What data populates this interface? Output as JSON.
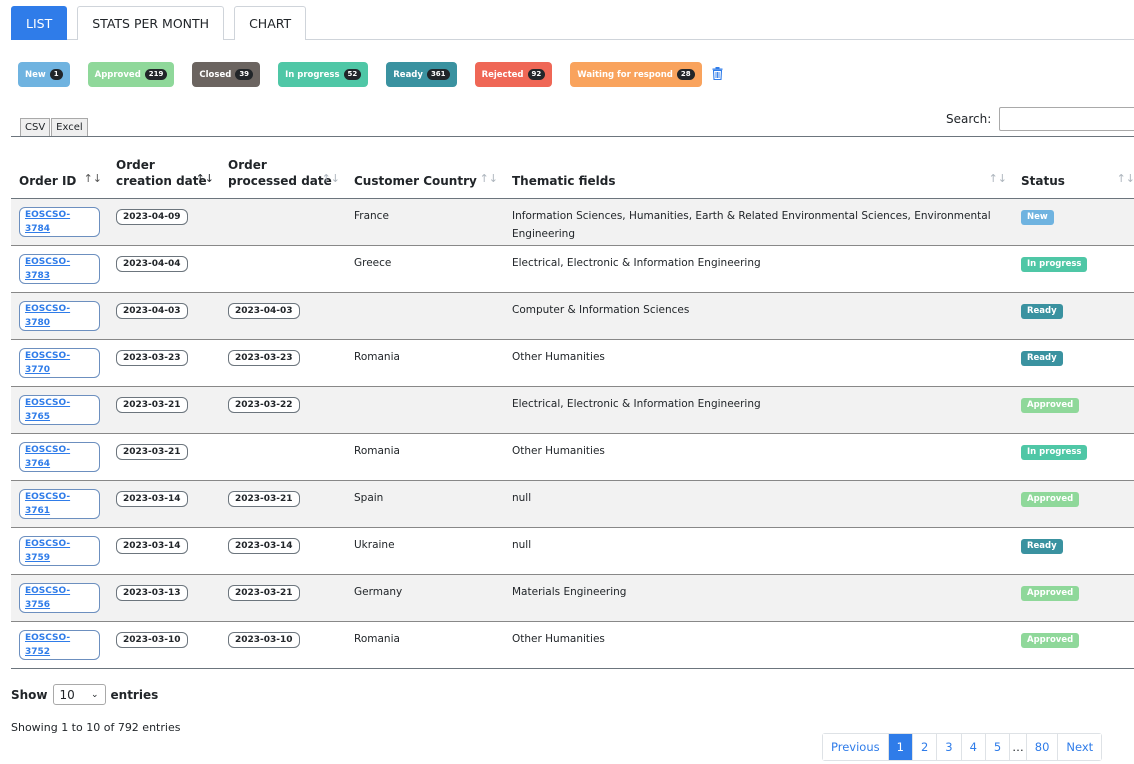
{
  "tabs": [
    {
      "label": "LIST",
      "active": true
    },
    {
      "label": "STATS PER MONTH",
      "active": false
    },
    {
      "label": "CHART",
      "active": false
    }
  ],
  "filters": [
    {
      "label": "New",
      "count": "1",
      "color": "#6fb3e0"
    },
    {
      "label": "Approved",
      "count": "219",
      "color": "#8fd89a"
    },
    {
      "label": "Closed",
      "count": "39",
      "color": "#6b6460"
    },
    {
      "label": "In progress",
      "count": "52",
      "color": "#4fc7a6"
    },
    {
      "label": "Ready",
      "count": "361",
      "color": "#3a92a0"
    },
    {
      "label": "Rejected",
      "count": "92",
      "color": "#ef6756"
    },
    {
      "label": "Waiting for respond",
      "count": "28",
      "color": "#f9a35d"
    }
  ],
  "exports": {
    "csv": "CSV",
    "excel": "Excel"
  },
  "search": {
    "label": "Search:",
    "value": ""
  },
  "columns": [
    "Order ID",
    "Order creation date",
    "Order processed date",
    "Customer Country",
    "Thematic fields",
    "Status"
  ],
  "rows": [
    {
      "id": "EOSCSO-3784",
      "created": "2023-04-09",
      "processed": "",
      "country": "France",
      "fields": "Information Sciences, Humanities, Earth & Related Environmental Sciences, Environmental Engineering",
      "status": "New"
    },
    {
      "id": "EOSCSO-3783",
      "created": "2023-04-04",
      "processed": "",
      "country": "Greece",
      "fields": "Electrical, Electronic & Information Engineering",
      "status": "In progress"
    },
    {
      "id": "EOSCSO-3780",
      "created": "2023-04-03",
      "processed": "2023-04-03",
      "country": "",
      "fields": "Computer & Information Sciences",
      "status": "Ready"
    },
    {
      "id": "EOSCSO-3770",
      "created": "2023-03-23",
      "processed": "2023-03-23",
      "country": "Romania",
      "fields": "Other Humanities",
      "status": "Ready"
    },
    {
      "id": "EOSCSO-3765",
      "created": "2023-03-21",
      "processed": "2023-03-22",
      "country": "",
      "fields": "Electrical, Electronic & Information Engineering",
      "status": "Approved"
    },
    {
      "id": "EOSCSO-3764",
      "created": "2023-03-21",
      "processed": "",
      "country": "Romania",
      "fields": "Other Humanities",
      "status": "In progress"
    },
    {
      "id": "EOSCSO-3761",
      "created": "2023-03-14",
      "processed": "2023-03-21",
      "country": "Spain",
      "fields": "null",
      "status": "Approved"
    },
    {
      "id": "EOSCSO-3759",
      "created": "2023-03-14",
      "processed": "2023-03-14",
      "country": "Ukraine",
      "fields": "null",
      "status": "Ready"
    },
    {
      "id": "EOSCSO-3756",
      "created": "2023-03-13",
      "processed": "2023-03-21",
      "country": "Germany",
      "fields": "Materials Engineering",
      "status": "Approved"
    },
    {
      "id": "EOSCSO-3752",
      "created": "2023-03-10",
      "processed": "2023-03-10",
      "country": "Romania",
      "fields": "Other Humanities",
      "status": "Approved"
    }
  ],
  "status_colors": {
    "New": "#6fb3e0",
    "Approved": "#8fd89a",
    "In progress": "#4fc7a6",
    "Ready": "#3a92a0"
  },
  "footer": {
    "show_label": "Show",
    "entries_label": "entries",
    "page_length": "10",
    "info": "Showing 1 to 10 of 792 entries"
  },
  "pagination": {
    "previous": "Previous",
    "pages": [
      "1",
      "2",
      "3",
      "4",
      "5"
    ],
    "ellipsis": "…",
    "last": "80",
    "next": "Next",
    "current": "1"
  }
}
